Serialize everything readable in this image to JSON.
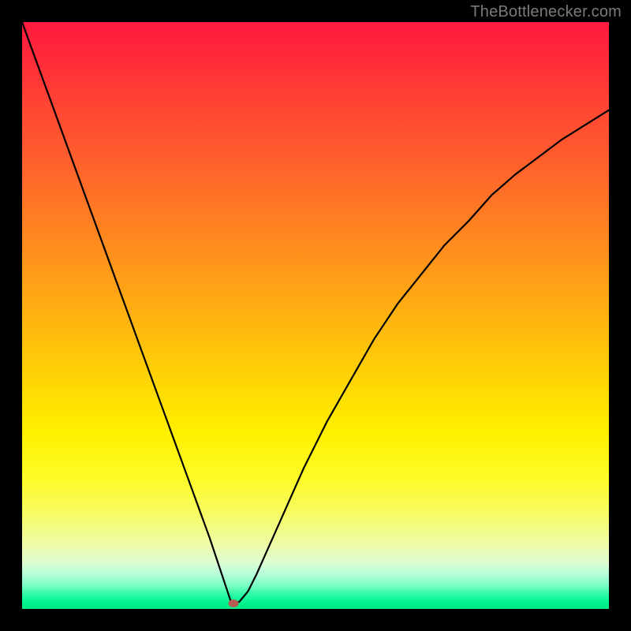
{
  "watermark": "TheBottlenecker.com",
  "chart_data": {
    "type": "line",
    "title": "",
    "xlabel": "",
    "ylabel": "",
    "xlim": [
      0,
      100
    ],
    "ylim": [
      0,
      100
    ],
    "grid": false,
    "background": "rainbow-gradient-red-to-green",
    "series": [
      {
        "name": "bottleneck-curve",
        "x": [
          0,
          4,
          8,
          12,
          16,
          20,
          24,
          28,
          32,
          34,
          35,
          35.5,
          36,
          37,
          38.5,
          40,
          44,
          48,
          52,
          56,
          60,
          64,
          68,
          72,
          76,
          80,
          84,
          88,
          92,
          96,
          100
        ],
        "values": [
          100,
          89,
          78,
          67,
          56,
          45,
          34,
          23,
          12,
          6,
          3,
          1.5,
          1,
          1.2,
          3,
          6,
          15,
          24,
          32,
          39,
          46,
          52,
          57,
          62,
          66,
          70.5,
          74,
          77,
          80,
          82.5,
          85
        ]
      }
    ],
    "annotations": [
      {
        "name": "optimal-point",
        "x": 36,
        "y": 1,
        "color": "#b75a52"
      }
    ]
  },
  "plot_geometry": {
    "inner_left": 28,
    "inner_top": 28,
    "inner_width": 744,
    "inner_height": 744
  }
}
